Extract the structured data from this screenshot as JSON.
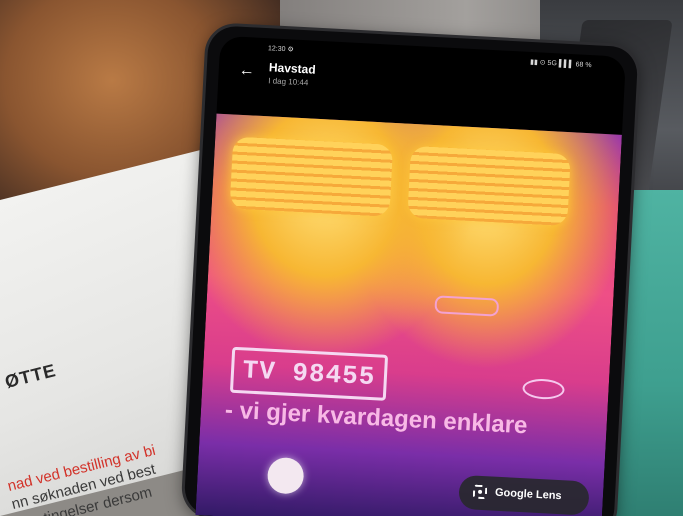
{
  "paper": {
    "heading": "ØTTE",
    "red_line": "nad ved bestilling av bi",
    "body_line_1": "nn søknaden ved best",
    "body_line_2": "betingelser dersom"
  },
  "phone": {
    "status_time": "12:30 ⚙",
    "status_icons": "▮▮ ⊙ 5G ▌▌▌ 68 %",
    "chat_name": "Havstad",
    "chat_date": "I dag 10:44",
    "back_icon": "←",
    "image": {
      "license_plate": "TV 98455",
      "slogan": "- vi gjer kvardagen enklare"
    },
    "google_lens_label": "Google Lens"
  },
  "colors": {
    "thermal_hot": "#ffd25a",
    "thermal_mid": "#ee4f86",
    "thermal_cold": "#321a66",
    "mat": "#4fb3a2"
  }
}
